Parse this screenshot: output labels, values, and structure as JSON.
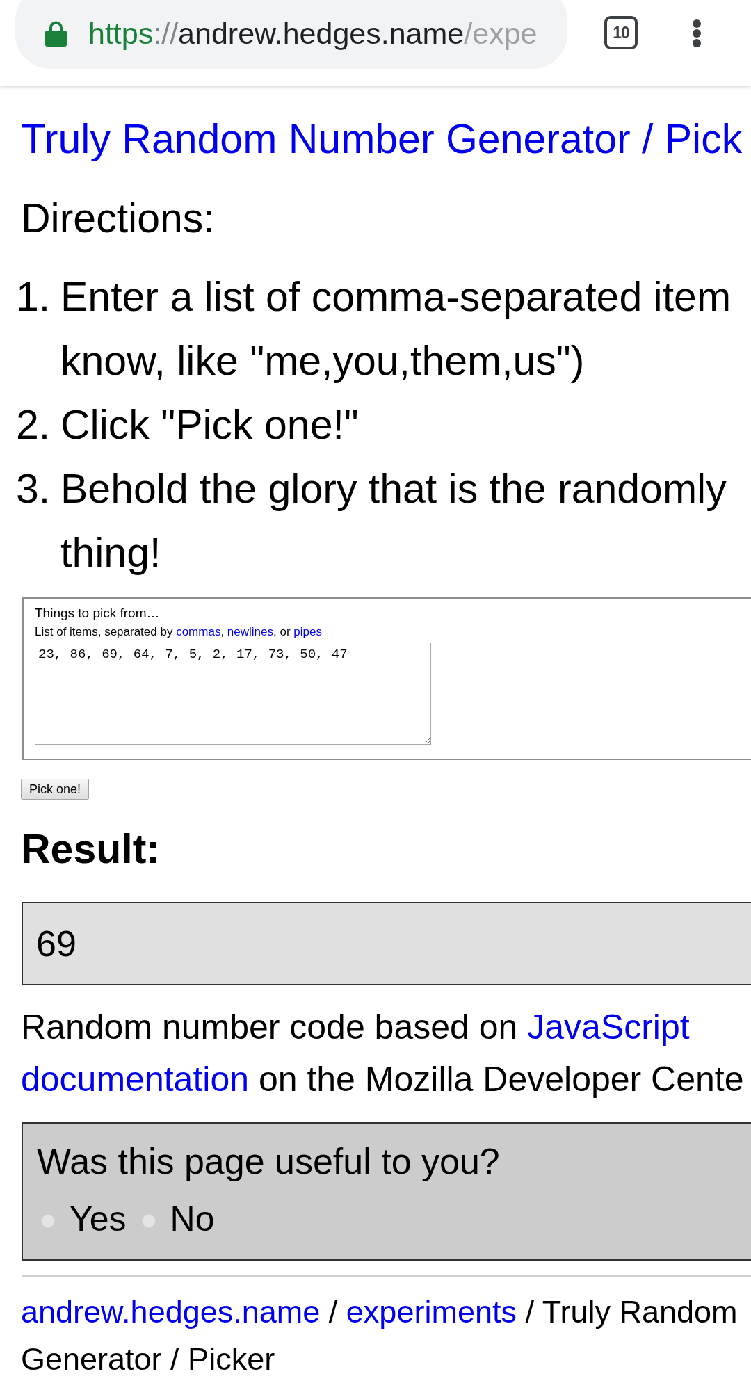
{
  "browser": {
    "secure": true,
    "url": [
      {
        "kind": "scheme",
        "text": "https"
      },
      {
        "kind": "separator",
        "text": "://"
      },
      {
        "kind": "host",
        "text": "andrew.hedges.name"
      },
      {
        "kind": "path",
        "text": "/expe"
      }
    ],
    "tab_count": "10"
  },
  "page": {
    "title_link": "Truly Random Number Generator / Pick",
    "directions_heading": "Directions:",
    "steps": [
      {
        "number": "1.",
        "lines": [
          "Enter a list of comma-separated item",
          "know, like \"me,you,them,us\")"
        ]
      },
      {
        "number": "2.",
        "lines": [
          "Click \"Pick one!\""
        ]
      },
      {
        "number": "3.",
        "lines": [
          "Behold the glory that is the randomly",
          "thing!"
        ]
      }
    ],
    "form": {
      "legend": "Things to pick from…",
      "hint": [
        {
          "kind": "text",
          "text": "List of items, separated by "
        },
        {
          "kind": "link",
          "text": "commas"
        },
        {
          "kind": "text",
          "text": ", "
        },
        {
          "kind": "link",
          "text": "newlines"
        },
        {
          "kind": "text",
          "text": ", or "
        },
        {
          "kind": "link",
          "text": "pipes"
        }
      ],
      "textarea": {
        "value": "23, 86, 69, 64, 7, 5, 2, 17, 73, 50, 47"
      },
      "button": "Pick one!"
    },
    "result": {
      "heading": "Result:",
      "value": "69"
    },
    "credit": {
      "lines": [
        [
          {
            "kind": "text",
            "text": "Random number code based on "
          },
          {
            "kind": "link",
            "text": "JavaScript"
          }
        ],
        [
          {
            "kind": "link",
            "text": "documentation"
          },
          {
            "kind": "text",
            "text": " on the Mozilla Developer Cente"
          }
        ]
      ]
    },
    "feedback": {
      "question": "Was this page useful to you?",
      "options": [
        {
          "label": "Yes",
          "selected": false
        },
        {
          "label": "No",
          "selected": false
        }
      ]
    },
    "breadcrumb": {
      "lines": [
        [
          {
            "kind": "link",
            "text": "andrew.hedges.name"
          },
          {
            "kind": "text",
            "text": " / "
          },
          {
            "kind": "link",
            "text": "experiments"
          },
          {
            "kind": "text",
            "text": " / Truly Random"
          }
        ],
        [
          {
            "kind": "text",
            "text": "Generator / Picker"
          }
        ]
      ]
    }
  }
}
